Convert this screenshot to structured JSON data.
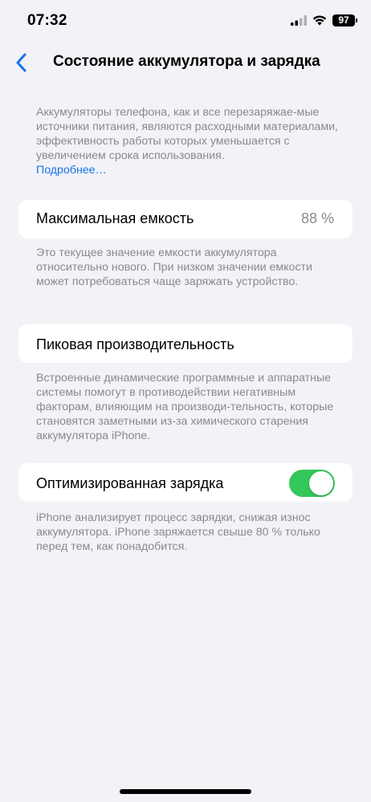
{
  "status_bar": {
    "time": "07:32",
    "battery_level": "97",
    "icons": [
      "signal-icon",
      "wifi-icon",
      "battery-icon"
    ]
  },
  "nav": {
    "back_icon": "chevron-left-icon",
    "title": "Состояние аккумулятора и зарядка"
  },
  "intro": {
    "text": "Аккумуляторы телефона, как и все перезаряжае-мые источники питания, являются расходными материалами, эффективность работы которых уменьшается с увеличением срока использования.",
    "link": "Подробнее…"
  },
  "max_capacity": {
    "label": "Максимальная емкость",
    "value": "88 %",
    "description": "Это текущее значение емкости аккумулятора относительно нового. При низком значении емкости может потребоваться чаще заряжать устройство."
  },
  "peak_performance": {
    "label": "Пиковая производительность",
    "description": "Встроенные динамические программные и аппаратные системы помогут в противодействии негативным факторам, влияющим на производи-тельность, которые становятся заметными из-за химического старения аккумулятора iPhone."
  },
  "optimized_charging": {
    "label": "Оптимизированная зарядка",
    "enabled": true,
    "description": "iPhone анализирует процесс зарядки, снижая износ аккумулятора. iPhone заряжается свыше 80 % только перед тем, как понадобится."
  },
  "colors": {
    "background": "#f2f2f7",
    "card": "#ffffff",
    "accent": "#1a73e8",
    "toggle_on": "#34c759",
    "secondary_text": "#8a8a8e"
  }
}
